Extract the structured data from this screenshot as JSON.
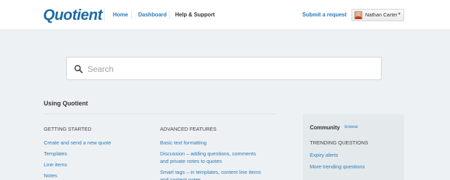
{
  "header": {
    "logo_text": "Quotient",
    "nav": [
      {
        "label": "Home",
        "active": false
      },
      {
        "label": "Dashboard",
        "active": false
      },
      {
        "label": "Help & Support",
        "active": true
      }
    ],
    "submit_request_label": "Submit a request",
    "user": {
      "name": "Nathan Carter",
      "caret": "▼"
    }
  },
  "search": {
    "placeholder": "Search",
    "value": "",
    "icon": "search-icon"
  },
  "section": {
    "title": "Using Quotient",
    "columns": [
      {
        "heading": "GETTING STARTED",
        "links": [
          "Create and send a new quote",
          "Templates",
          "Line items",
          "Notes"
        ]
      },
      {
        "heading": "ADVANCED FEATURES",
        "links": [
          "Basic text formatting",
          "Discussion – adding questions, comments and private notes to quotes",
          "Smart tags – in templates, content line items and content notes"
        ]
      }
    ]
  },
  "community": {
    "title": "Community",
    "browse_label": "browse",
    "trending_heading": "TRENDING QUESTIONS",
    "links": [
      "Expiry alerts",
      "More trending questions"
    ]
  },
  "colors": {
    "link": "#2a7ab8",
    "logo": "#1b6aa5",
    "page_bg": "#eef1f3",
    "panel_bg": "#e4e9ec"
  }
}
